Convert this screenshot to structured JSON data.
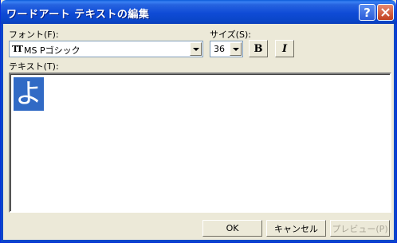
{
  "window": {
    "title": "ワードアート テキストの編集",
    "help_label": "?",
    "close_label": "✕"
  },
  "font": {
    "label": "フォント(F):",
    "value": "MS Pゴシック",
    "icon": "truetype-font-icon"
  },
  "size": {
    "label": "サイズ(S):",
    "value": "36"
  },
  "format": {
    "bold_label": "B",
    "italic_label": "I"
  },
  "text": {
    "label": "テキスト(T):",
    "value": "よ"
  },
  "buttons": {
    "ok": "OK",
    "cancel": "キャンセル",
    "preview": "プレビュー(P)"
  },
  "colors": {
    "titlebar": "#0a46c9",
    "selection": "#316ac5",
    "dialog_bg": "#ece9d8"
  }
}
